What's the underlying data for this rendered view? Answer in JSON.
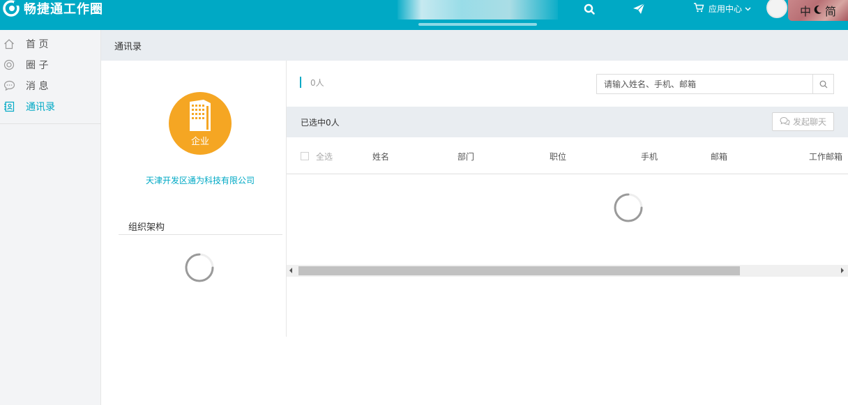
{
  "header": {
    "logo_text": "畅捷通工作圈",
    "app_center_label": "应用中心",
    "lang_left": "中",
    "lang_right": "简"
  },
  "nav": {
    "items": [
      {
        "label": "首 页",
        "icon": "home-icon"
      },
      {
        "label": "圈 子",
        "icon": "circle-icon"
      },
      {
        "label": "消 息",
        "icon": "message-icon"
      },
      {
        "label": "通讯录",
        "icon": "contacts-icon",
        "active": true
      }
    ]
  },
  "breadcrumb": {
    "title": "通讯录"
  },
  "company": {
    "badge_label": "企业",
    "name": "天津开发区通为科技有限公司",
    "org_title": "组织架构"
  },
  "contacts": {
    "count_label": "0人",
    "search_placeholder": "请输入姓名、手机、邮箱",
    "selected_label": "已选中0人",
    "chat_button_label": "发起聊天",
    "columns": {
      "select_all": "全选",
      "name": "姓名",
      "dept": "部门",
      "position": "职位",
      "phone": "手机",
      "email": "邮箱",
      "work_email": "工作邮箱"
    }
  },
  "colors": {
    "brand": "#00a9c5",
    "enterprise": "#f5a623",
    "panel_bg": "#e9edf1"
  }
}
